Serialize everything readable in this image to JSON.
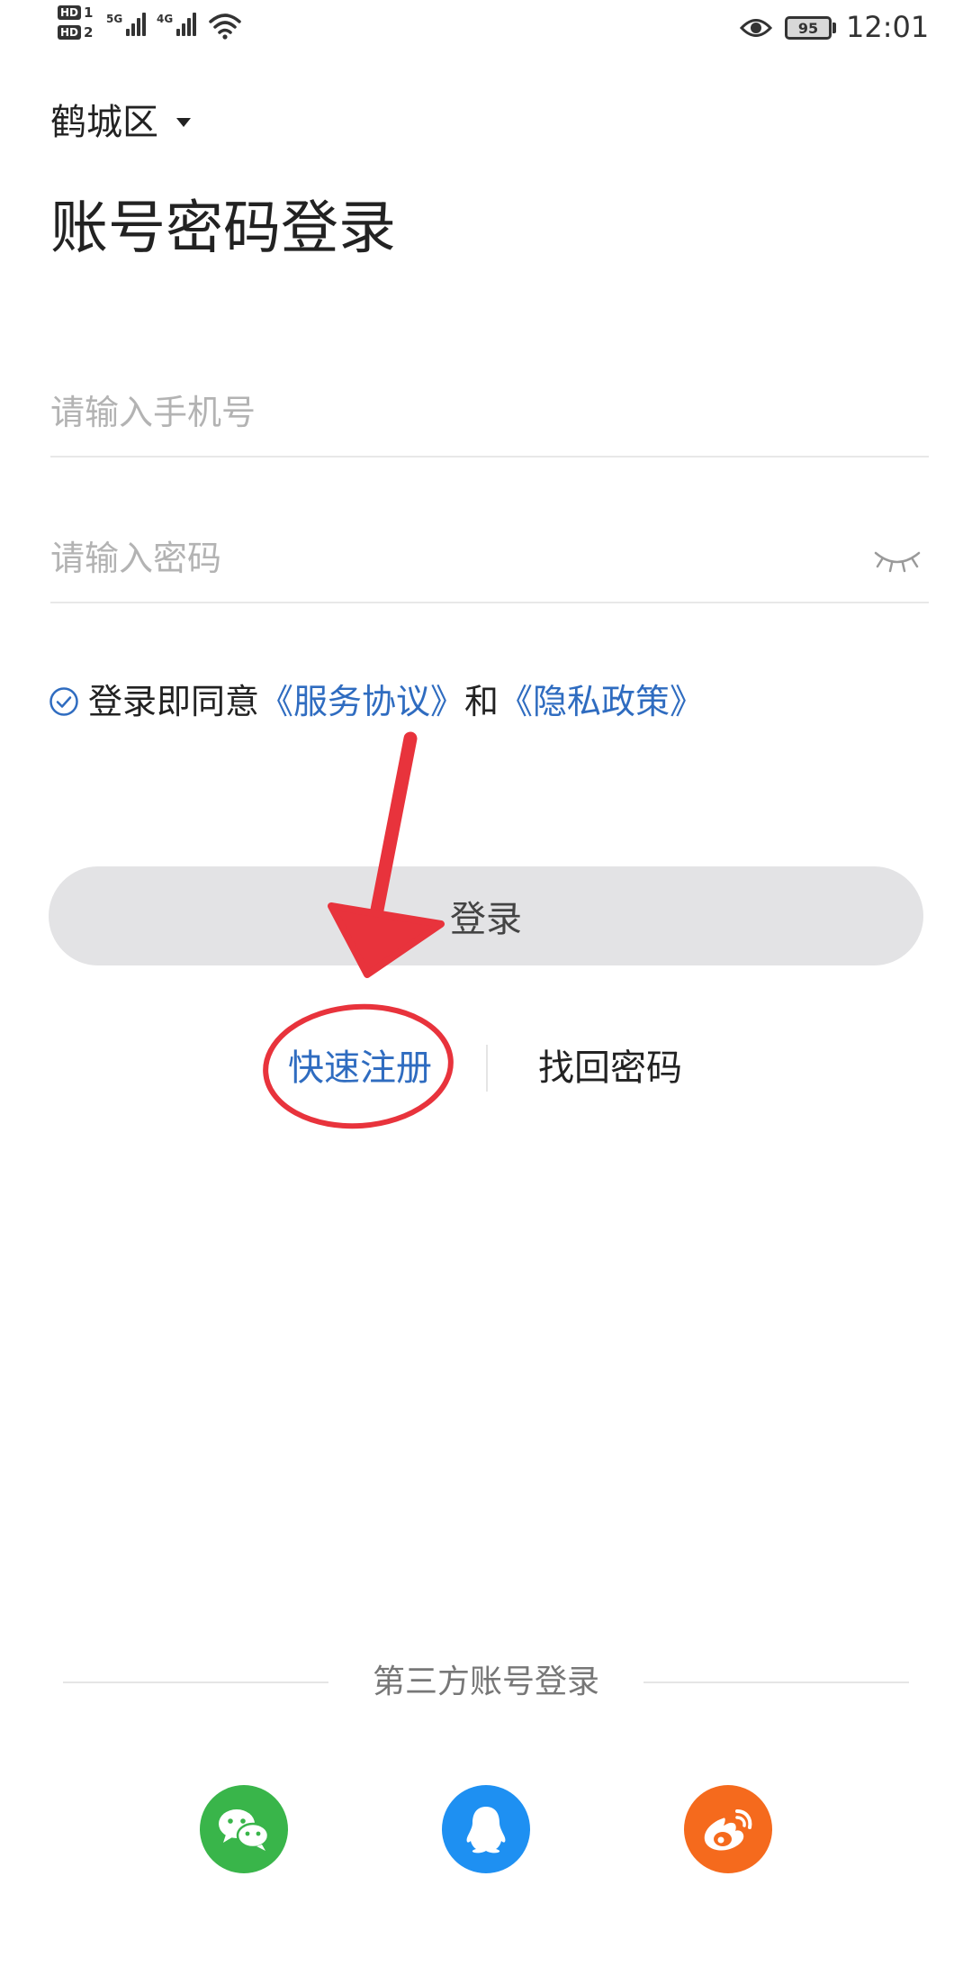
{
  "status_bar": {
    "hd1": "HD",
    "hd1_index": "1",
    "hd2": "HD",
    "hd2_index": "2",
    "network_1": "5G",
    "network_2": "4G",
    "battery": "95",
    "time": "12:01"
  },
  "location": {
    "name": "鹤城区"
  },
  "title": "账号密码登录",
  "form": {
    "phone_placeholder": "请输入手机号",
    "password_placeholder": "请输入密码"
  },
  "agreement": {
    "prefix": "登录即同意",
    "terms": "《服务协议》",
    "and": "和",
    "privacy": "《隐私政策》"
  },
  "login_button": "登录",
  "links": {
    "quick_register": "快速注册",
    "recover_password": "找回密码"
  },
  "third_party": {
    "label": "第三方账号登录",
    "providers": [
      "wechat-icon",
      "qq-icon",
      "weibo-icon"
    ]
  },
  "colors": {
    "accent_blue": "#2f6cc0",
    "annotation_red": "#e8333c",
    "wechat": "#39b54a",
    "qq": "#1e90f2",
    "weibo": "#f56a1d"
  }
}
